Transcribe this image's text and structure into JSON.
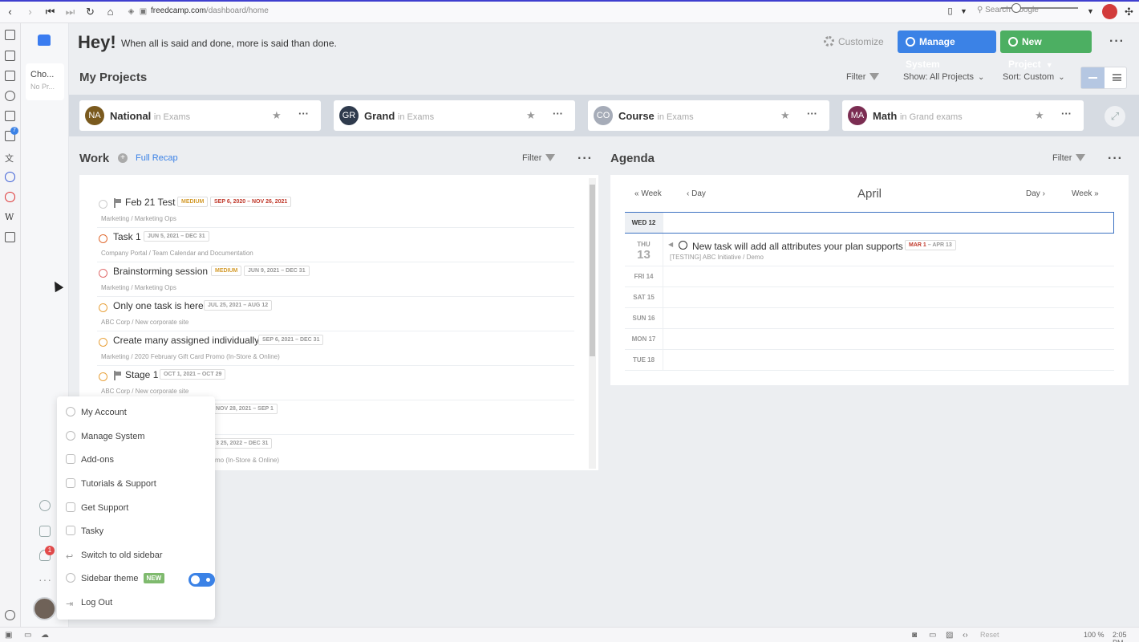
{
  "browser": {
    "url_host": "freedcamp.com",
    "url_path": "/dashboard/home",
    "search_placeholder": "Search Google"
  },
  "sidebar": {
    "project_chip_title": "Cho...",
    "project_chip_sub": "No Pr...",
    "notif_count": "1",
    "bookmark_badge": "7"
  },
  "header": {
    "greeting": "Hey!",
    "quote": "When all is said and done, more is said than done.",
    "customize": "Customize",
    "manage_system": "Manage System",
    "new_project": "New Project"
  },
  "projects": {
    "title": "My Projects",
    "filter": "Filter",
    "show": "Show: All Projects",
    "sort": "Sort: Custom",
    "items": [
      {
        "initials": "NA",
        "name": "National",
        "group": "in Exams",
        "color": "#7a5a1e"
      },
      {
        "initials": "GR",
        "name": "Grand",
        "group": "in Exams",
        "color": "#2f3b4d"
      },
      {
        "initials": "CO",
        "name": "Course",
        "group": "in Exams",
        "color": "#a6acb8"
      },
      {
        "initials": "MA",
        "name": "Math",
        "group": "in Grand exams",
        "color": "#7b2d52"
      }
    ]
  },
  "work": {
    "title": "Work",
    "recap": "Full Recap",
    "filter": "Filter",
    "tasks": [
      {
        "name": "Feb 21 Test",
        "priority": "MEDIUM",
        "dates": "SEP 6, 2020 – NOV 26, 2021",
        "path": "Marketing / Marketing Ops",
        "status_color": "#cccccc"
      },
      {
        "name": "Task 1",
        "priority": "",
        "dates": "JUN 5, 2021 – DEC 31",
        "path": "Company Portal / Team Calendar and Documentation",
        "status_color": "#e0692f"
      },
      {
        "name": "Brainstorming session",
        "priority": "MEDIUM",
        "dates": "JUN 9, 2021 – DEC 31",
        "path": "Marketing / Marketing Ops",
        "status_color": "#e06b6b"
      },
      {
        "name": "Only one task is here",
        "priority": "",
        "dates": "JUL 25, 2021 – AUG 12",
        "path": "ABC Corp / New corporate site",
        "status_color": "#e8a13a"
      },
      {
        "name": "Create many assigned individually",
        "priority": "",
        "dates": "SEP 6, 2021 – DEC 31",
        "path": "Marketing / 2020 February Gift Card Promo (In-Store & Online)",
        "status_color": "#e8a13a"
      },
      {
        "name": "Stage 1",
        "priority": "",
        "dates": "OCT 1, 2021 – OCT 29",
        "path": "ABC Corp / New corporate site",
        "status_color": "#e8a13a"
      }
    ],
    "partial_dates_1": "NOV 28, 2021 – SEP 1",
    "partial_dates_2": "3 25, 2022 – DEC 31",
    "partial_path_2": "mo (In-Store & Online)"
  },
  "agenda": {
    "title": "Agenda",
    "filter": "Filter",
    "month": "April",
    "nav_prev_week": "Week",
    "nav_prev_day": "Day",
    "nav_next_day": "Day",
    "nav_next_week": "Week",
    "days": [
      {
        "label": "WED 12"
      },
      {
        "label": "THU",
        "num": "13"
      },
      {
        "label": "FRI 14"
      },
      {
        "label": "SAT 15"
      },
      {
        "label": "SUN 16"
      },
      {
        "label": "MON 17"
      },
      {
        "label": "TUE 18"
      }
    ],
    "event": {
      "name": "New task will add all attributes your plan supports",
      "date_start": "MAR 1",
      "date_end": "– APR 13",
      "path": "[TESTING] ABC Initiative / Demo"
    }
  },
  "menu": {
    "items": [
      "My Account",
      "Manage System",
      "Add-ons",
      "Tutorials & Support",
      "Get Support",
      "Tasky",
      "Switch to old sidebar",
      "Sidebar theme",
      "Log Out"
    ],
    "new_badge": "NEW"
  },
  "status": {
    "reset": "Reset",
    "zoom": "100 %",
    "time": "2:05 PM"
  }
}
